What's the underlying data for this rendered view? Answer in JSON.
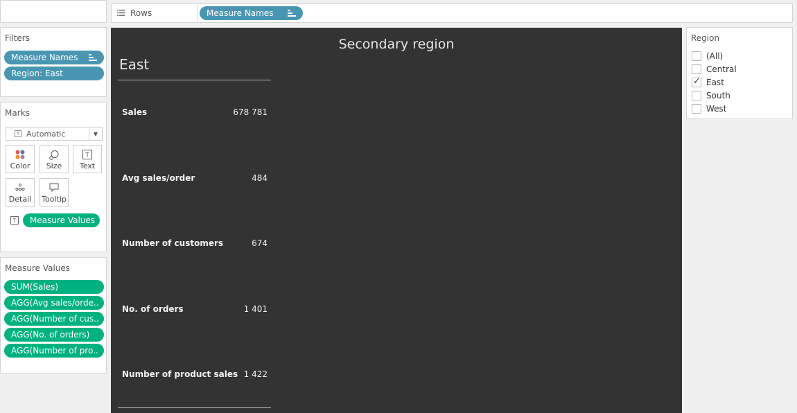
{
  "rows_shelf": {
    "label": "Rows",
    "pill": "Measure Names"
  },
  "filters": {
    "title": "Filters",
    "pills": [
      "Measure Names",
      "Region: East"
    ]
  },
  "marks": {
    "title": "Marks",
    "type": "Automatic",
    "buttons": [
      "Color",
      "Size",
      "Text",
      "Detail",
      "Tooltip"
    ],
    "text_pill": "Measure Values"
  },
  "measure_values": {
    "title": "Measure Values",
    "pills": [
      "SUM(Sales)",
      "AGG(Avg sales/orde..",
      "AGG(Number of cus..",
      "AGG(No. of orders)",
      "AGG(Number of pro.."
    ]
  },
  "viz": {
    "title": "Secondary region",
    "region": "East",
    "rows": [
      {
        "label": "Sales",
        "value": "678 781"
      },
      {
        "label": "Avg sales/order",
        "value": "484"
      },
      {
        "label": "Number of customers",
        "value": "674"
      },
      {
        "label": "No. of orders",
        "value": "1 401"
      },
      {
        "label": "Number of product sales",
        "value": "1 422"
      }
    ]
  },
  "region_filter": {
    "title": "Region",
    "options": [
      {
        "label": "(All)",
        "checked": false
      },
      {
        "label": "Central",
        "checked": false
      },
      {
        "label": "East",
        "checked": true
      },
      {
        "label": "South",
        "checked": false
      },
      {
        "label": "West",
        "checked": false
      }
    ]
  },
  "colors": {
    "pill_blue": "#4996b2",
    "pill_green": "#00b180",
    "viz_bg": "#333333"
  }
}
